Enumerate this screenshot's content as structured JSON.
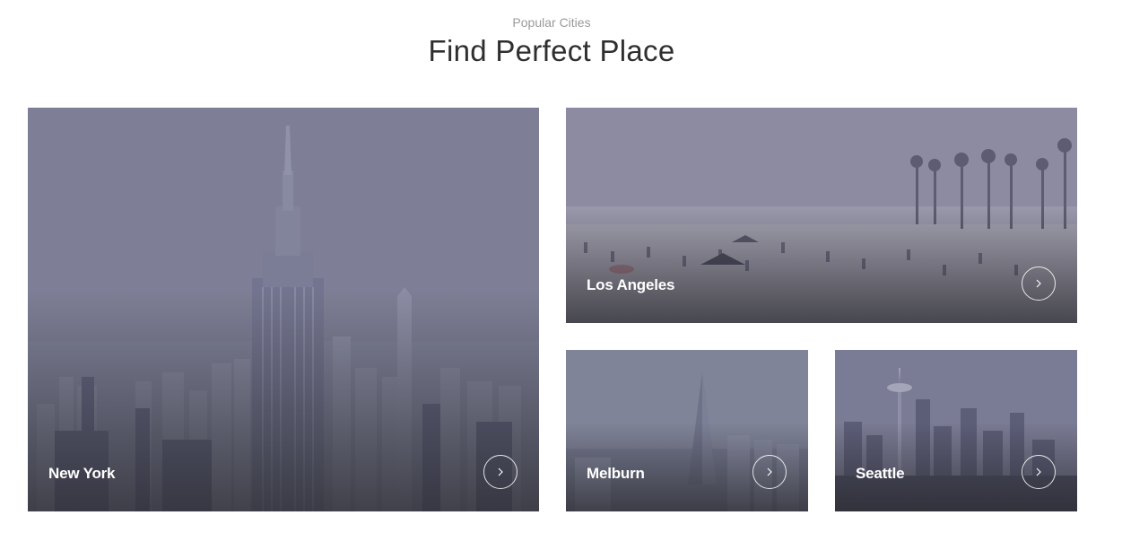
{
  "section": {
    "eyebrow": "Popular Cities",
    "title": "Find Perfect Place"
  },
  "cities": [
    {
      "name": "New York",
      "icon": "chevron-right-icon"
    },
    {
      "name": "Los Angeles",
      "icon": "chevron-right-icon"
    },
    {
      "name": "Melburn",
      "icon": "chevron-right-icon"
    },
    {
      "name": "Seattle",
      "icon": "chevron-right-icon"
    }
  ],
  "colors": {
    "overlay": "#7a7b93",
    "headline": "#2f2f2f",
    "eyebrow": "#9a9a9a"
  }
}
